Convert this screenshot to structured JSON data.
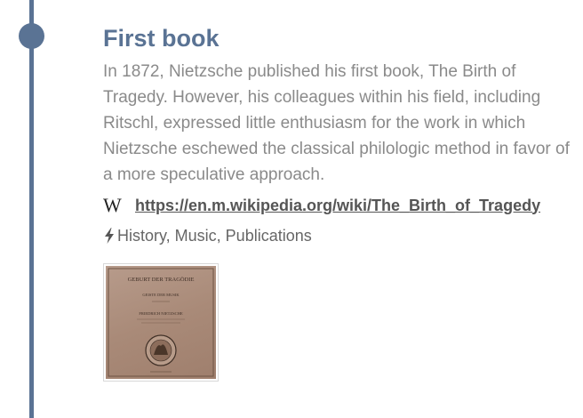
{
  "entry": {
    "title": "First book",
    "description": "In 1872, Nietzsche published his first book, The Birth of Tragedy. However, his colleagues within his field, including Ritschl, expressed little enthusiasm for the work in which Nietzsche eschewed the classical philologic method in favor of a more speculative approach.",
    "wiki_icon": "W",
    "link_text": "https://en.m.wikipedia.org/wiki/The_Birth_of_Tragedy",
    "tags": "History, Music, Publications"
  },
  "thumbnail": {
    "cover_line_1": "GEBURT DER TRAGÖDIE",
    "cover_line_2": "GEISTE DER MUSIK",
    "cover_author": "FRIEDRICH NIETZSCHE"
  },
  "colors": {
    "accent": "#5a7394",
    "text": "#8a8a8a",
    "link": "#555555"
  },
  "icons": [
    "wikipedia-icon",
    "lightning-bolt-icon"
  ]
}
